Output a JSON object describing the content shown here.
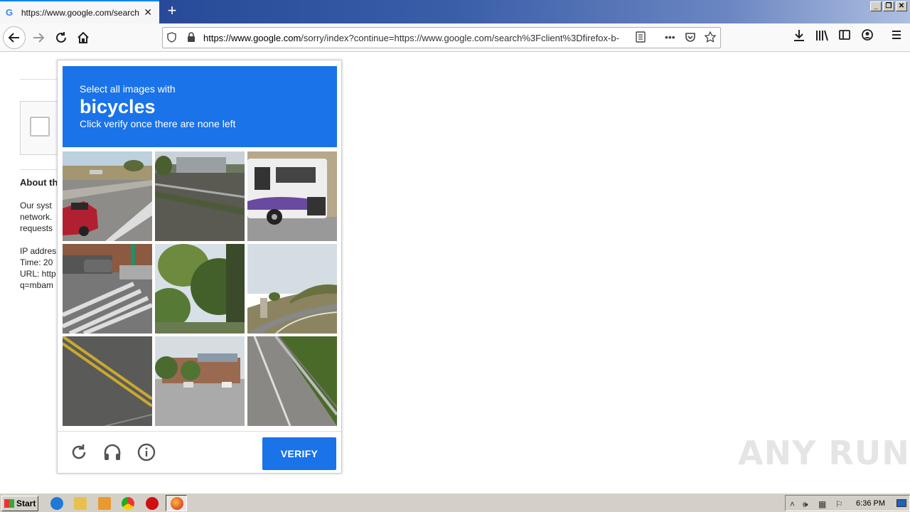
{
  "browser": {
    "tab_title": "https://www.google.com/search?c",
    "tab_favicon": "G",
    "close_glyph": "✕",
    "new_tab_glyph": "+",
    "url_host": "https://www.google.com",
    "url_rest": "/sorry/index?continue=https://www.google.com/search%3Fclient%3Dfirefox-b-"
  },
  "page": {
    "about_heading": "About th",
    "line1": "Our syst",
    "line2": "network.",
    "line3": "requests",
    "line4": "IP addres",
    "line5": "Time: 20",
    "line6": "URL: http",
    "line7": "q=mbam"
  },
  "captcha": {
    "instruction": "Select all images with",
    "target": "bicycles",
    "hint": "Click verify once there are none left",
    "verify_label": "VERIFY",
    "tiles": [
      "red car on road",
      "road with guardrail",
      "bus",
      "crosswalk with parked cars",
      "trees",
      "hillside road",
      "road with yellow lines",
      "building with parking lot",
      "highway with guardrail"
    ]
  },
  "watermark": "ANY RUN",
  "taskbar": {
    "start_label": "Start",
    "clock": "6:36 PM"
  }
}
